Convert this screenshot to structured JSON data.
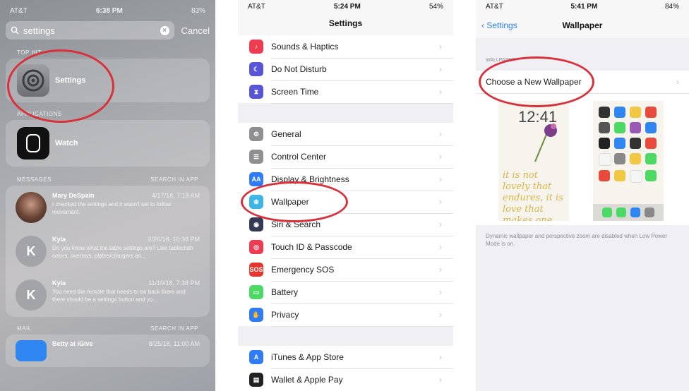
{
  "search_screen": {
    "status": {
      "carrier": "AT&T",
      "time": "6:38 PM",
      "battery": "83%"
    },
    "search_value": "settings",
    "cancel_label": "Cancel",
    "top_hit_header": "TOP HIT",
    "top_hit_app": "Settings",
    "applications_header": "APPLICATIONS",
    "app": "Watch",
    "messages_header": "MESSAGES",
    "messages_action": "Search in App",
    "messages": [
      {
        "from": "Mary DeSpain",
        "date": "4/17/18, 7:19 AM",
        "text": "I checked the settings and it wasn't set to follow movement.",
        "initial": ""
      },
      {
        "from": "Kyla",
        "date": "2/26/18, 10:38 PM",
        "text": "Do you know what the table settings are? Like tablecloth colors, overlays, plates/chargers an...",
        "initial": "K"
      },
      {
        "from": "Kyla",
        "date": "11/10/18, 7:38 PM",
        "text": "You need the remote that needs to be back there and there should be a settings button and yo...",
        "initial": "K"
      }
    ],
    "mail_header": "MAIL",
    "mail_action": "Search in App",
    "mail_from": "Betty at iGive",
    "mail_date": "8/25/18, 11:00 AM"
  },
  "settings_screen": {
    "status": {
      "carrier": "AT&T",
      "time": "5:24 PM",
      "battery": "54%"
    },
    "title": "Settings",
    "groups": [
      [
        {
          "label": "Sounds & Haptics",
          "color": "#ef3b50",
          "glyph": "♪"
        },
        {
          "label": "Do Not Disturb",
          "color": "#5856d6",
          "glyph": "☾"
        },
        {
          "label": "Screen Time",
          "color": "#5856d6",
          "glyph": "⧗"
        }
      ],
      [
        {
          "label": "General",
          "color": "#8e8e93",
          "glyph": "⚙"
        },
        {
          "label": "Control Center",
          "color": "#8e8e93",
          "glyph": "☰"
        },
        {
          "label": "Display & Brightness",
          "color": "#2f7cf6",
          "glyph": "AA"
        },
        {
          "label": "Wallpaper",
          "color": "#3db5e6",
          "glyph": "❀"
        },
        {
          "label": "Siri & Search",
          "color": "#333a56",
          "glyph": "◉"
        },
        {
          "label": "Touch ID & Passcode",
          "color": "#ef3b50",
          "glyph": "◎"
        },
        {
          "label": "Emergency SOS",
          "color": "#e5352f",
          "glyph": "SOS"
        },
        {
          "label": "Battery",
          "color": "#4cd964",
          "glyph": "▭"
        },
        {
          "label": "Privacy",
          "color": "#2f7cf6",
          "glyph": "✋"
        }
      ],
      [
        {
          "label": "iTunes & App Store",
          "color": "#2f7cf6",
          "glyph": "A"
        },
        {
          "label": "Wallet & Apple Pay",
          "color": "#222222",
          "glyph": "▤"
        }
      ]
    ]
  },
  "wallpaper_screen": {
    "status": {
      "carrier": "AT&T",
      "time": "5:41 PM",
      "battery": "84%"
    },
    "back_label": "Settings",
    "title": "Wallpaper",
    "section_header": "WALLPAPER",
    "choose_label": "Choose a New Wallpaper",
    "lock_time": "12:41",
    "lock_script": "it is not lovely that endures, it is love that makes one lovely",
    "note": "Dynamic wallpaper and perspective zoom are disabled when Low Power Mode is on."
  },
  "colors": {
    "highlight_ring": "#d8313b",
    "ios_blue": "#2b7de9"
  }
}
